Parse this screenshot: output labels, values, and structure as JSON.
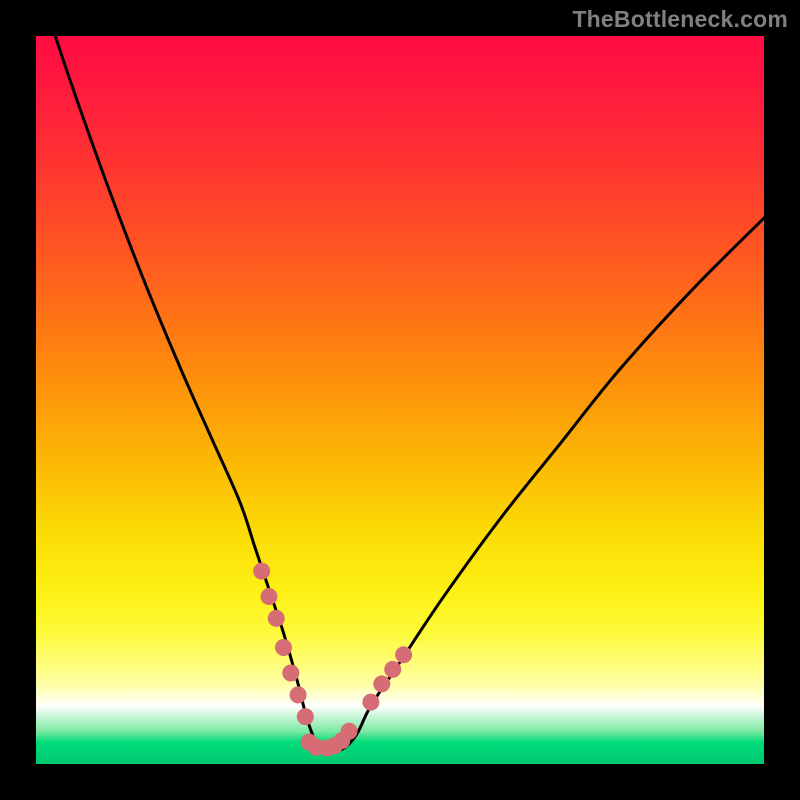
{
  "watermark": "TheBottleneck.com",
  "colors": {
    "background": "#000000",
    "curve_stroke": "#000000",
    "highlight_stroke": "#d66d75",
    "highlight_stroke_2": "#d66d75"
  },
  "chart_data": {
    "type": "line",
    "title": "",
    "xlabel": "",
    "ylabel": "",
    "xlim": [
      0,
      100
    ],
    "ylim": [
      0,
      100
    ],
    "grid": false,
    "series": [
      {
        "name": "bottleneck-curve",
        "x": [
          2,
          5,
          10,
          15,
          20,
          24,
          28,
          30,
          32,
          34,
          36,
          37,
          38,
          39,
          40,
          42,
          44,
          46,
          50,
          56,
          64,
          72,
          80,
          90,
          100
        ],
        "values": [
          102,
          93,
          79,
          66,
          54,
          45,
          36,
          30,
          24,
          18,
          11,
          7,
          4,
          2,
          2,
          2,
          4,
          8,
          14,
          23,
          34,
          44,
          54,
          65,
          75
        ]
      }
    ],
    "annotations": [
      {
        "name": "highlight-left-descent",
        "style": "dashed",
        "x": [
          31,
          32,
          33,
          34,
          35,
          36,
          37
        ],
        "values": [
          26.5,
          23,
          20,
          16,
          12.5,
          9.5,
          6.5
        ]
      },
      {
        "name": "highlight-bottom",
        "style": "dashed",
        "x": [
          37.5,
          38.5,
          40,
          41,
          42,
          43
        ],
        "values": [
          3,
          2.3,
          2.2,
          2.5,
          3.2,
          4.5
        ]
      },
      {
        "name": "highlight-right-ascent",
        "style": "dashed",
        "x": [
          46,
          47.5,
          49,
          50.5
        ],
        "values": [
          8.5,
          11,
          13,
          15
        ]
      }
    ]
  }
}
